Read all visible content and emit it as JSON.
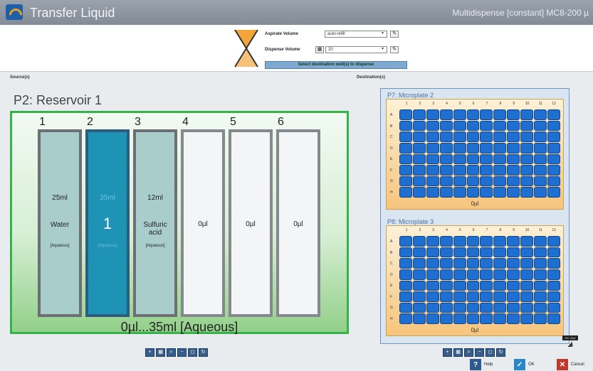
{
  "window": {
    "title": "Transfer Liquid",
    "mode": "Multidispense [constant] MC8-200 µ"
  },
  "controls": {
    "aspirate_label": "Aspirate Volume",
    "aspirate_value": "auto-refill",
    "dispense_label": "Dispense Volume",
    "dispense_value": "20",
    "select_destination": "Select destination well(s) to dispense"
  },
  "source": {
    "section_label": "Source(s)",
    "title": "P2: Reservoir 1",
    "range_label": "0µl...35ml [Aqueous]",
    "wells": [
      {
        "col": "1",
        "volume": "25ml",
        "name": "Water",
        "state": "[Aqueous]",
        "style": "filled"
      },
      {
        "col": "2",
        "volume": "35ml",
        "name": "",
        "state": "[Aqueous]",
        "style": "sel",
        "index": "1"
      },
      {
        "col": "3",
        "volume": "12ml",
        "name": "Sulfuric acid",
        "state": "[Aqueous]",
        "style": "filled"
      },
      {
        "col": "4",
        "volume": "0µl",
        "name": "",
        "state": "",
        "style": "empty"
      },
      {
        "col": "5",
        "volume": "0µl",
        "name": "",
        "state": "",
        "style": "empty"
      },
      {
        "col": "6",
        "volume": "0µl",
        "name": "",
        "state": "",
        "style": "empty"
      }
    ]
  },
  "destination": {
    "section_label": "Destination(s)",
    "plates": [
      {
        "title": "P7: Microplate 2",
        "volume": "0µl"
      },
      {
        "title": "P8: Microplate 3",
        "volume": "0µl"
      }
    ],
    "col_headers": [
      "1",
      "2",
      "3",
      "4",
      "5",
      "6",
      "7",
      "8",
      "9",
      "10",
      "11",
      "12"
    ],
    "row_headers": [
      "A",
      "B",
      "C",
      "D",
      "E",
      "F",
      "G",
      "H"
    ],
    "tooltip": "H4: 20µl"
  },
  "footer": {
    "help": "Help",
    "ok": "OK",
    "cancel": "Cancel"
  },
  "colors": {
    "accent": "#1f6fd1",
    "reservoir_border": "#36b24a",
    "well_fill": "#a9cdcb",
    "well_selected": "#1e93b6"
  }
}
